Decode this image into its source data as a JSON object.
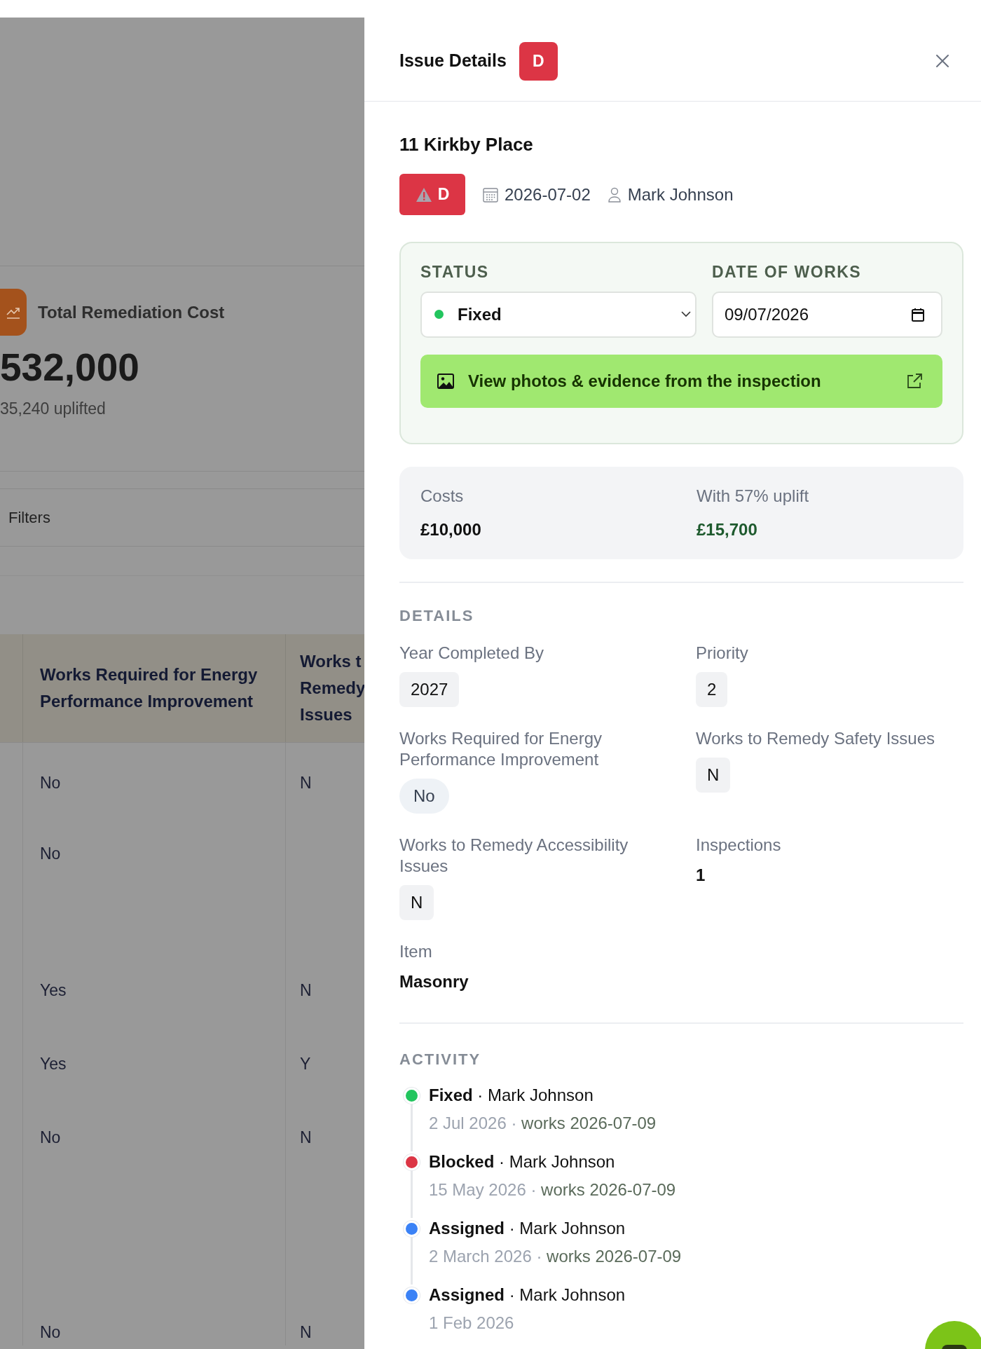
{
  "background_page": {
    "summary_card": {
      "title": "Total Remediation Cost",
      "value": "532,000",
      "subtitle": "35,240 uplifted"
    },
    "filters_label": "Filters",
    "table": {
      "columns": [
        "Works Required for Energy Performance Improvement",
        "Works t\nRemedy\nIssues"
      ],
      "rows": [
        [
          "No",
          "N"
        ],
        [
          "No"
        ],
        [
          "Yes",
          "N"
        ],
        [
          "Yes",
          "Y"
        ],
        [
          "No",
          "N"
        ],
        [
          "No",
          "N"
        ]
      ]
    }
  },
  "panel": {
    "title": "Issue Details",
    "grade_badge": "D",
    "address": "11 Kirkby Place",
    "rating_badge": "D",
    "date": "2026-07-02",
    "assignee": "Mark Johnson",
    "status": {
      "label": "STATUS",
      "value": "Fixed",
      "color": "#22c55e"
    },
    "date_of_works": {
      "label": "DATE OF WORKS",
      "value": "09/07/2026"
    },
    "evidence_button": "View photos & evidence from the inspection",
    "costs": [
      {
        "kind": "base",
        "label": "Costs",
        "value": "£10,000"
      },
      {
        "kind": "uplift",
        "label": "With 57% uplift",
        "value": "£15,700"
      }
    ],
    "details": {
      "heading": "DETAILS",
      "fields": [
        {
          "kind": "chip",
          "label": "Year Completed By",
          "value": "2027"
        },
        {
          "kind": "chip",
          "label": "Priority",
          "value": "2"
        },
        {
          "kind": "pill",
          "label": "Works Required for Energy Performance Improvement",
          "value": "No"
        },
        {
          "kind": "chip",
          "label": "Works to Remedy Safety Issues",
          "value": "N"
        },
        {
          "kind": "chip",
          "label": "Works to Remedy Accessibility Issues",
          "value": "N"
        },
        {
          "kind": "plain",
          "label": "Inspections",
          "value": "1"
        },
        {
          "kind": "plain",
          "label": "Item",
          "value": "Masonry"
        }
      ]
    },
    "activity": {
      "heading": "ACTIVITY",
      "separator": "·",
      "items": [
        {
          "status": "Fixed",
          "color": "#22c55e",
          "user": "Mark Johnson",
          "date": "2 Jul 2026",
          "works": "works 2026-07-09"
        },
        {
          "status": "Blocked",
          "color": "#dc3545",
          "user": "Mark Johnson",
          "date": "15 May 2026",
          "works": "works 2026-07-09"
        },
        {
          "status": "Assigned",
          "color": "#3b82f6",
          "user": "Mark Johnson",
          "date": "2 March 2026",
          "works": "works 2026-07-09"
        },
        {
          "status": "Assigned",
          "color": "#3b82f6",
          "user": "Mark Johnson",
          "date": "1 Feb 2026"
        }
      ]
    }
  }
}
